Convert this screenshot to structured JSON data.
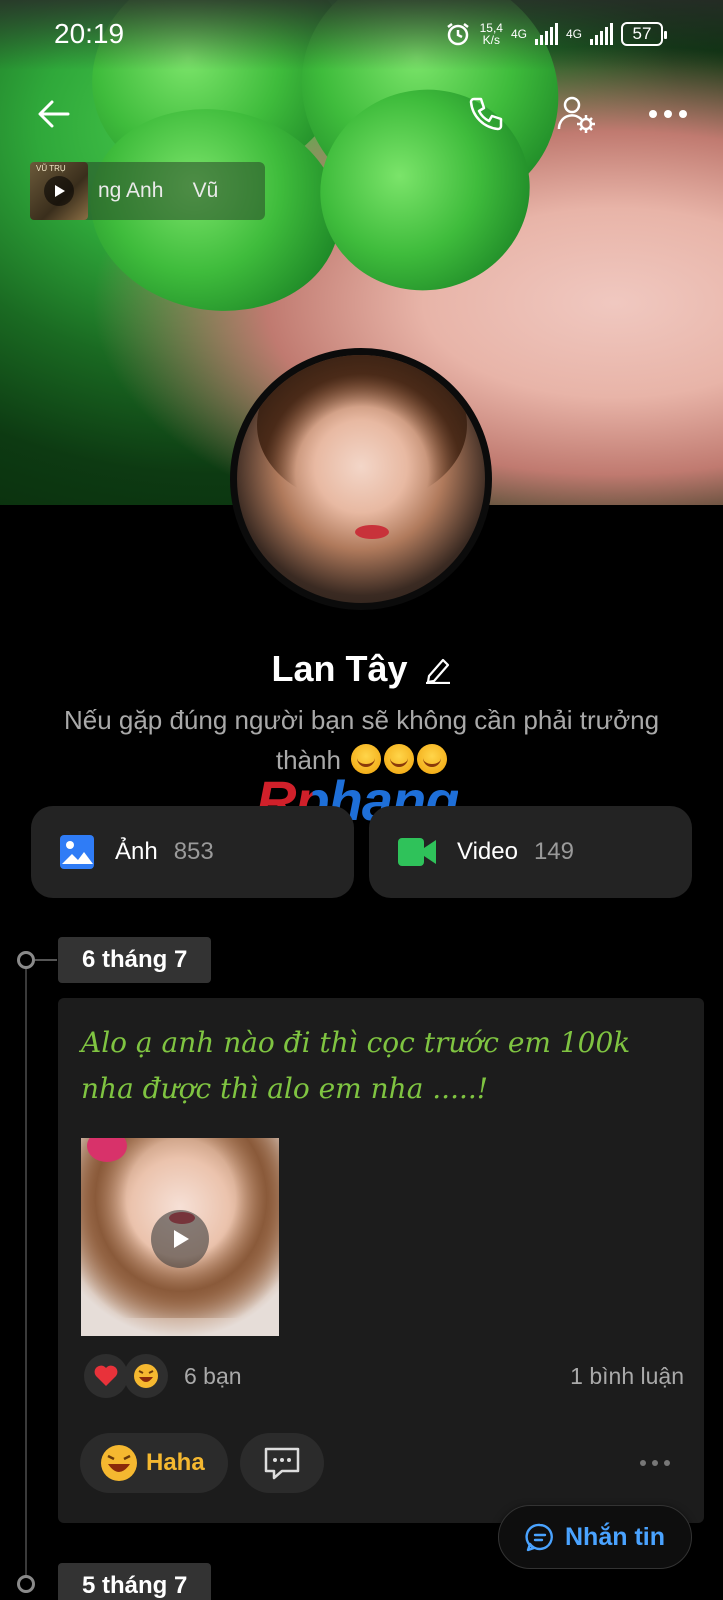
{
  "status_bar": {
    "time": "20:19",
    "net_speed_value": "15,4",
    "net_speed_unit": "K/s",
    "network_1": "4G",
    "network_2": "4G",
    "battery": "57"
  },
  "top_bar": {
    "back_icon": "arrow-left-icon",
    "call_icon": "phone-icon",
    "settings_icon": "user-gear-icon",
    "more_icon": "more-horizontal-icon"
  },
  "music": {
    "title_snippet": "ng Anh     Vũ",
    "album_text": "VŨ TRỤ"
  },
  "profile": {
    "name": "Lan Tây",
    "bio": "Nếu gặp đúng người bạn sẽ không cần phải trưởng thành",
    "bio_emoji_count": 3
  },
  "watermark": "Rphang",
  "media": {
    "photos_label": "Ảnh",
    "photos_count": "853",
    "videos_label": "Video",
    "videos_count": "149",
    "photos_color": "#2f7cf6",
    "videos_color": "#2fc25a"
  },
  "timeline": {
    "date_1": "6 tháng 7",
    "date_2": "5 tháng 7"
  },
  "post": {
    "text": "Alo ạ anh nào đi thì cọc trước em 100k nha được thì alo em nha .....!",
    "text_color": "#7fc441",
    "reactions_count": "6 bạn",
    "comments_count": "1 bình luận",
    "reaction_button_label": "Haha"
  },
  "message_button": {
    "label": "Nhắn tin",
    "color": "#4aa3ff"
  }
}
